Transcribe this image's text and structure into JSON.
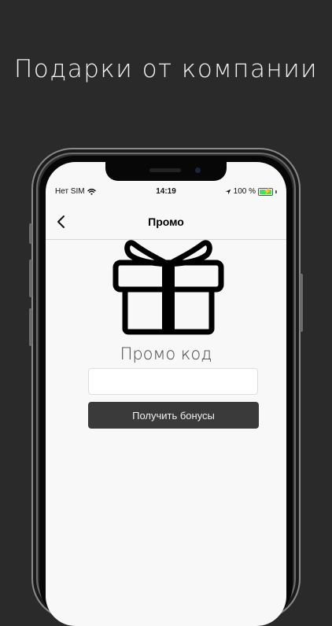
{
  "headline": "Подарки от компании",
  "status_bar": {
    "carrier": "Нет SIM",
    "time": "14:19",
    "battery": "100 %"
  },
  "nav": {
    "title": "Промо",
    "back_icon": "chevron-left-icon"
  },
  "promo": {
    "icon": "gift-icon",
    "label": "Промо код",
    "input_value": "",
    "input_placeholder": "",
    "button_label": "Получить бонусы"
  },
  "colors": {
    "background": "#2a2a2a",
    "button": "#3a3a3a",
    "battery": "#4cd964"
  }
}
